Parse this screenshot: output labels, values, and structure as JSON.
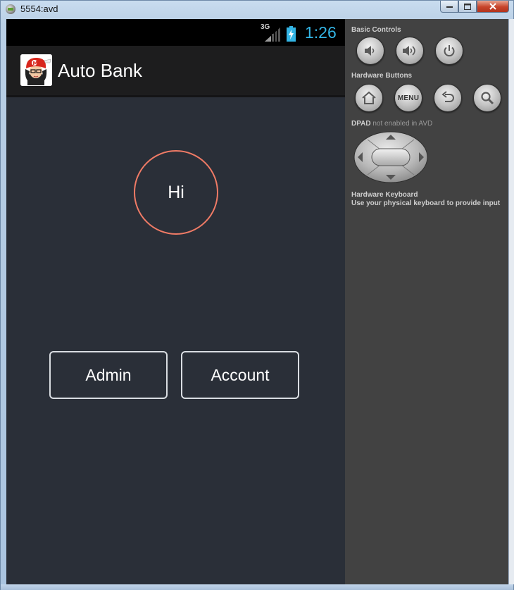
{
  "window": {
    "title": "5554:avd"
  },
  "statusbar": {
    "network": "3G",
    "clock": "1:26"
  },
  "actionbar": {
    "app_title": "Auto Bank",
    "logo_icon": "avatar-logo-icon"
  },
  "main": {
    "greeting": "Hi",
    "admin_label": "Admin",
    "account_label": "Account"
  },
  "controls": {
    "basic_controls_label": "Basic Controls",
    "hardware_buttons_label": "Hardware Buttons",
    "menu_label": "MENU",
    "dpad_label": "DPAD",
    "dpad_note": "not enabled in AVD",
    "keyboard_title": "Hardware Keyboard",
    "keyboard_hint": "Use your physical keyboard to provide input"
  },
  "colors": {
    "screen_bg": "#2a2f38",
    "accent_clock": "#33b5e5",
    "circle_stroke": "#f07b66",
    "panel_bg": "#424242"
  }
}
